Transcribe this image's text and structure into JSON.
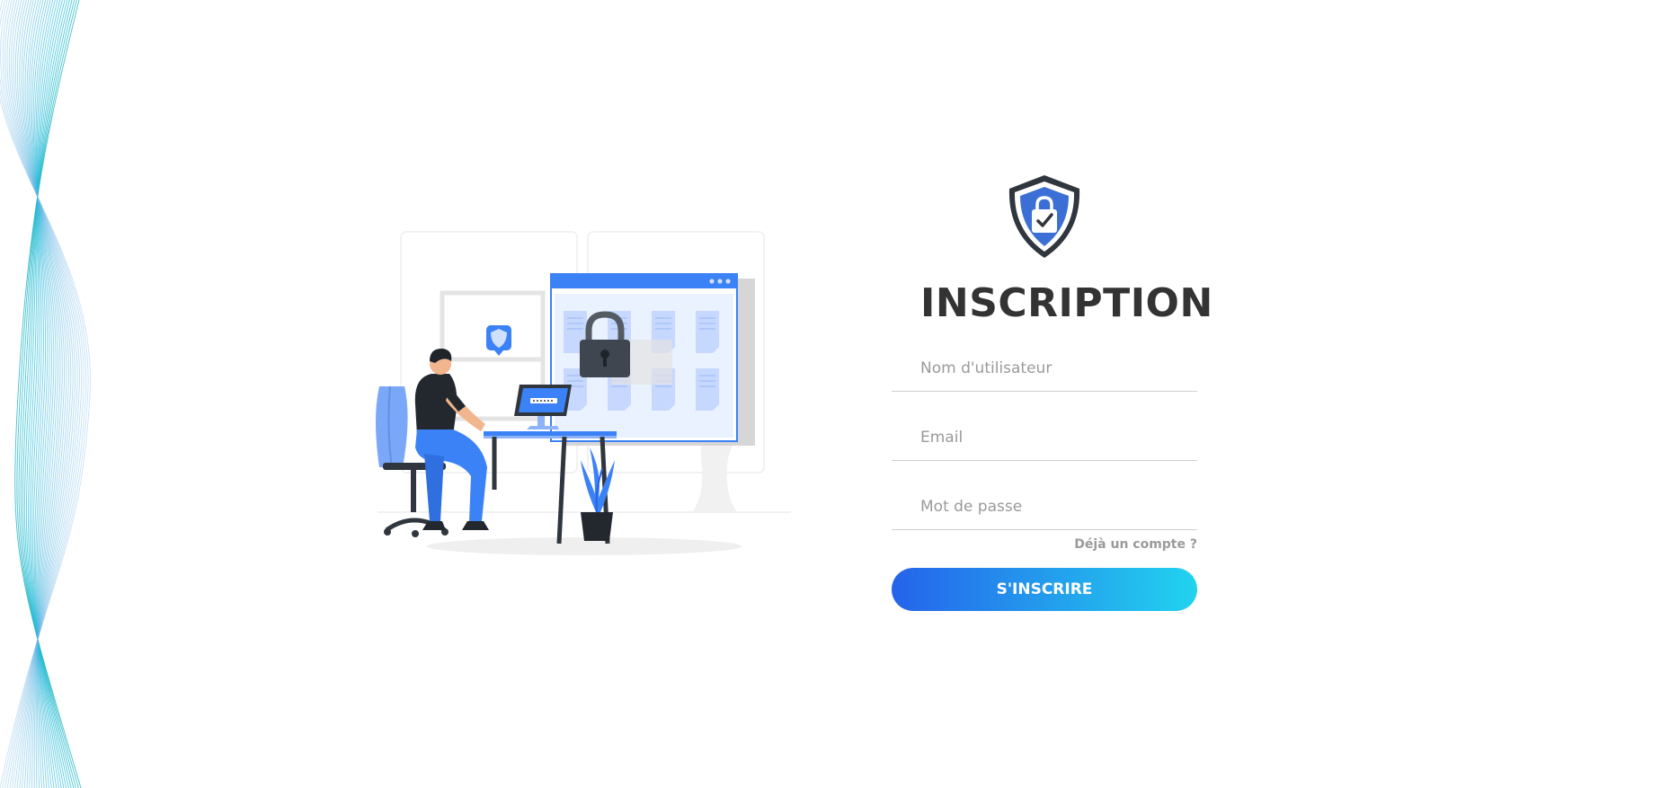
{
  "form": {
    "title": "INSCRIPTION",
    "username_placeholder": "Nom d'utilisateur",
    "email_placeholder": "Email",
    "password_placeholder": "Mot de passe",
    "already_account_label": "Déjà un compte ?",
    "submit_label": "S'INSCRIRE"
  },
  "icons": {
    "logo": "shield-lock-check-icon",
    "illustration": "person-at-desk-security-illustration",
    "decoration": "wave-lines-decoration"
  },
  "colors": {
    "accent_start": "#2563eb",
    "accent_end": "#22d3ee",
    "shield_fill": "#3b6fd6",
    "title_text": "#333333",
    "placeholder_text": "#9a9a9a"
  }
}
